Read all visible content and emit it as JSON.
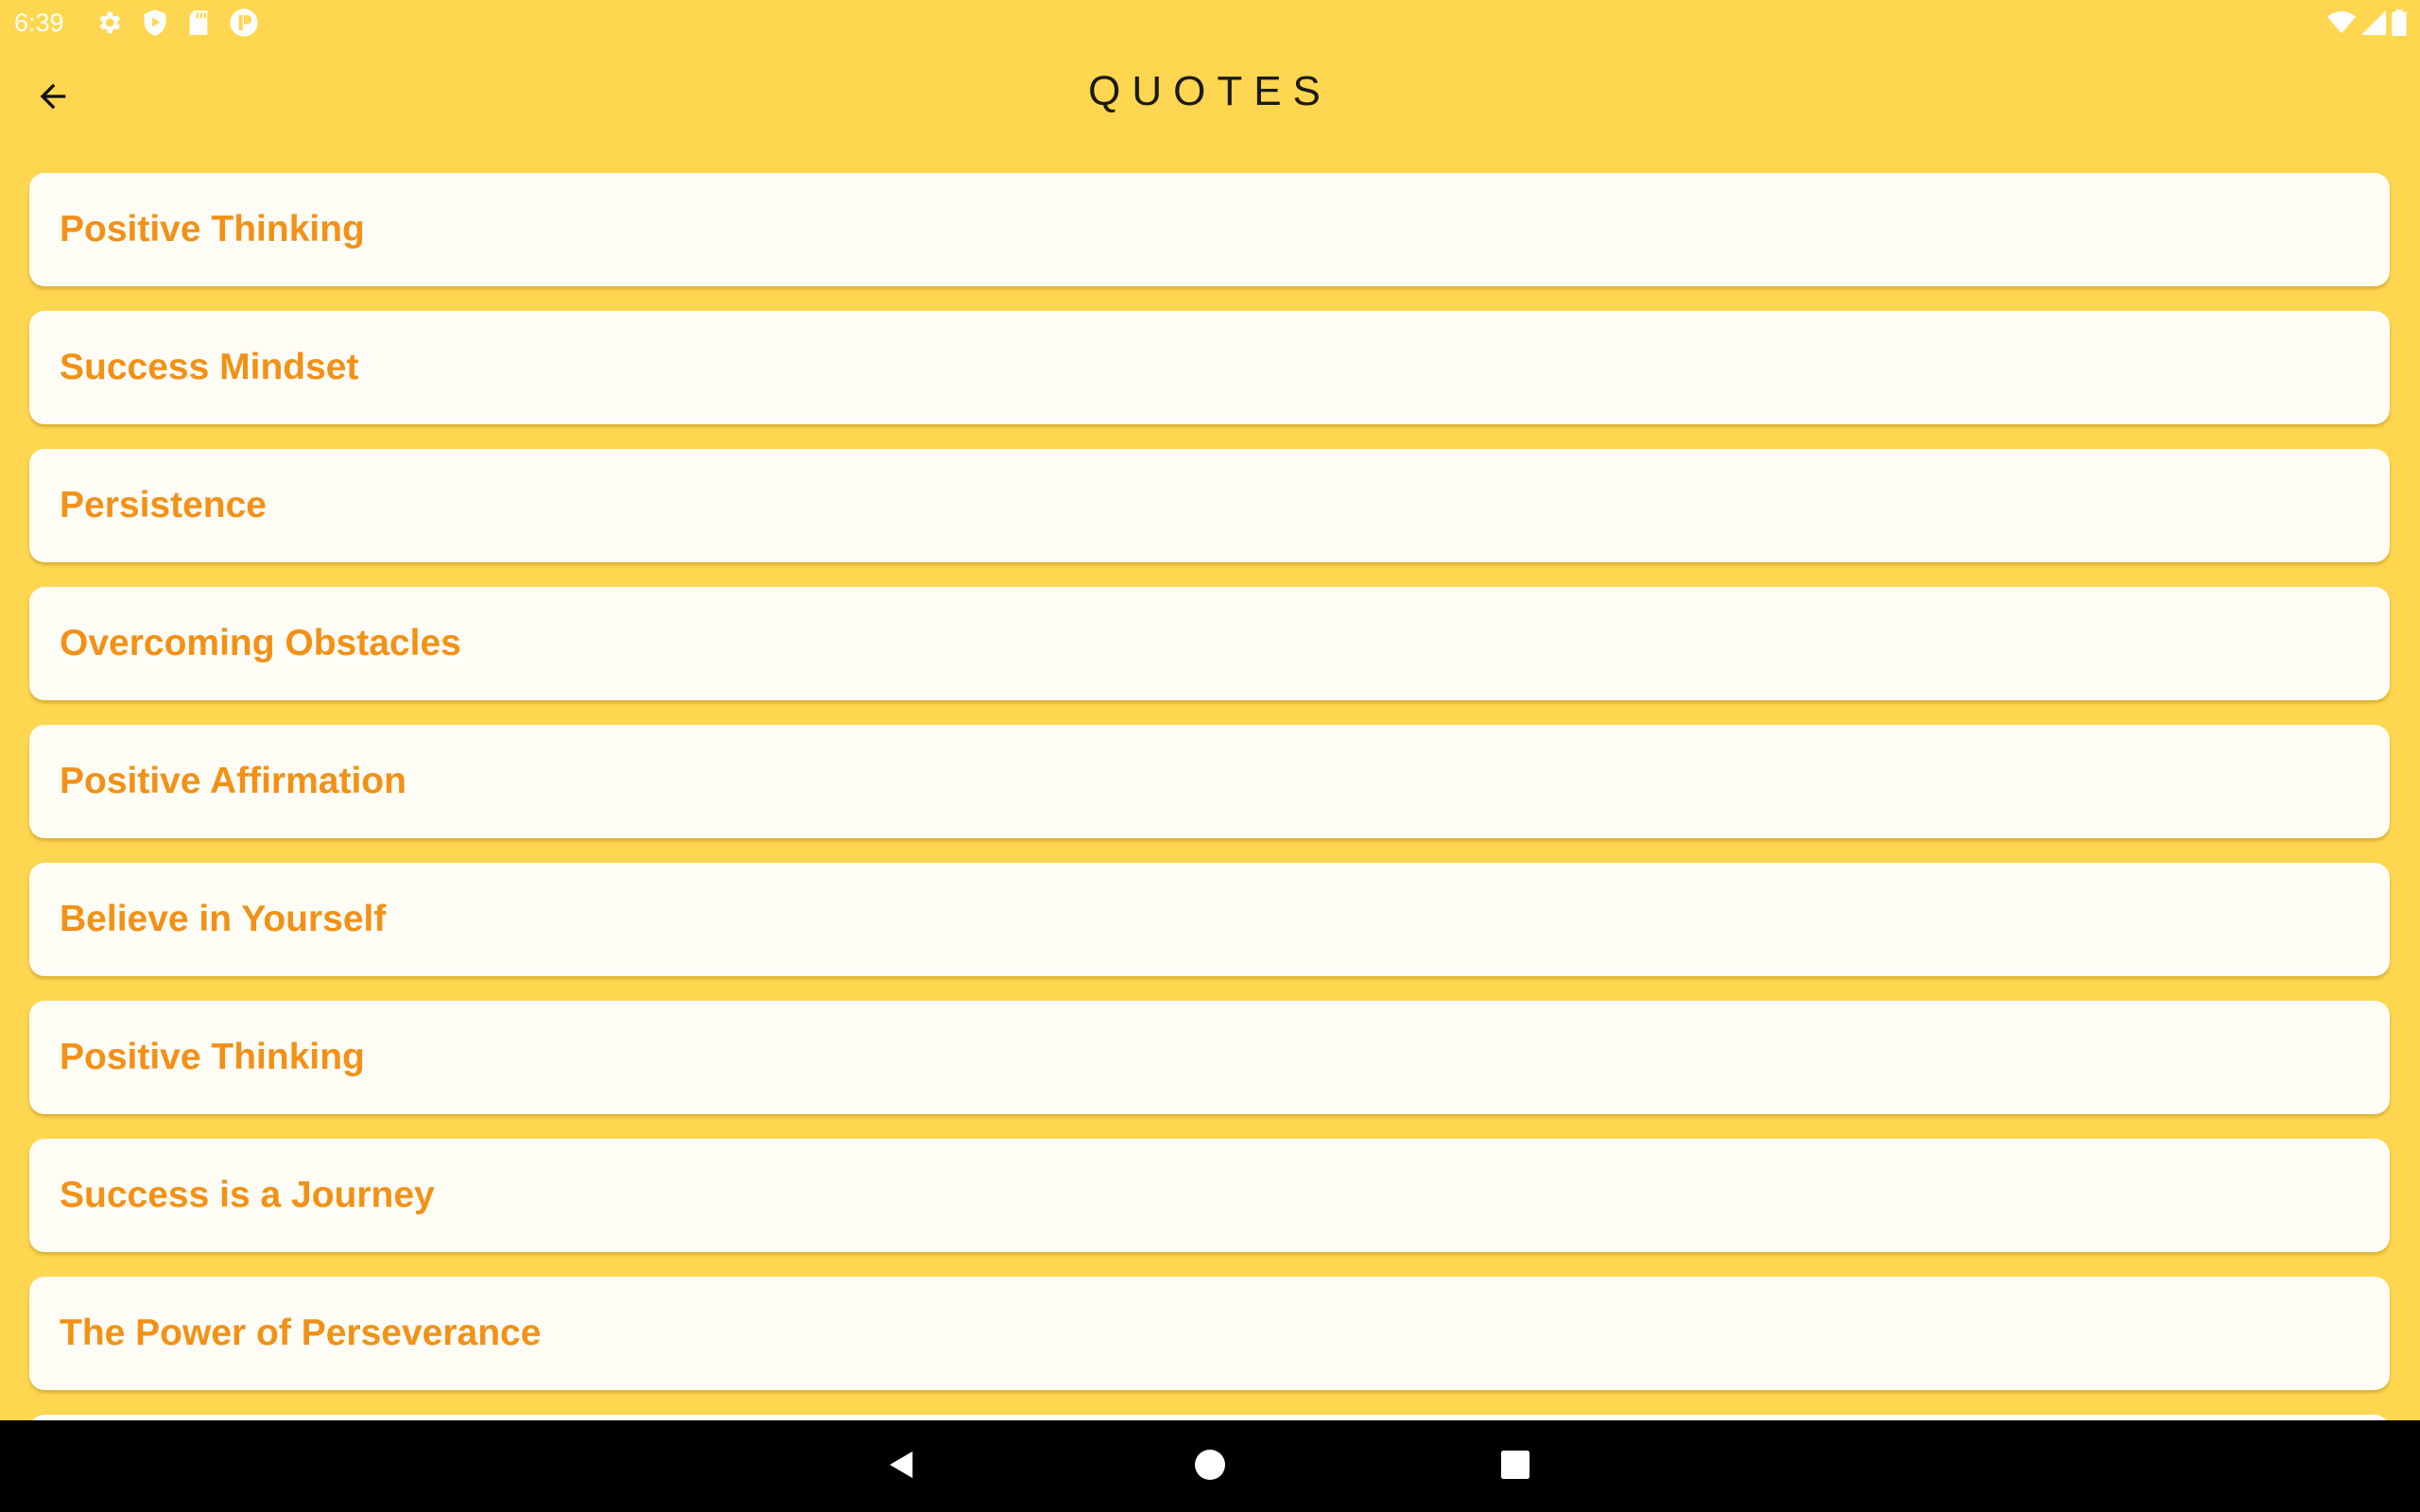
{
  "status_bar": {
    "time": "6:39",
    "left_icons": [
      "settings-icon",
      "play-protect-icon",
      "sd-card-icon",
      "app-notification-icon"
    ],
    "right_icons": [
      "wifi-icon",
      "signal-icon",
      "battery-icon"
    ]
  },
  "app_bar": {
    "title": "QUOTES",
    "back_icon": "arrow-left-icon"
  },
  "quotes_list": {
    "items": [
      {
        "label": "Positive Thinking"
      },
      {
        "label": "Success Mindset"
      },
      {
        "label": "Persistence"
      },
      {
        "label": "Overcoming Obstacles"
      },
      {
        "label": "Positive Affirmation"
      },
      {
        "label": "Believe in Yourself"
      },
      {
        "label": "Positive Thinking"
      },
      {
        "label": "Success is a Journey"
      },
      {
        "label": "The Power of Perseverance"
      }
    ]
  },
  "nav_bar": {
    "buttons": [
      "back-triangle-icon",
      "home-circle-icon",
      "recents-square-icon"
    ]
  },
  "colors": {
    "background": "#FFD64F",
    "card": "#FFFDF6",
    "card_text": "#F29116",
    "title_text": "#1a1a1a",
    "nav_bar": "#000000"
  }
}
